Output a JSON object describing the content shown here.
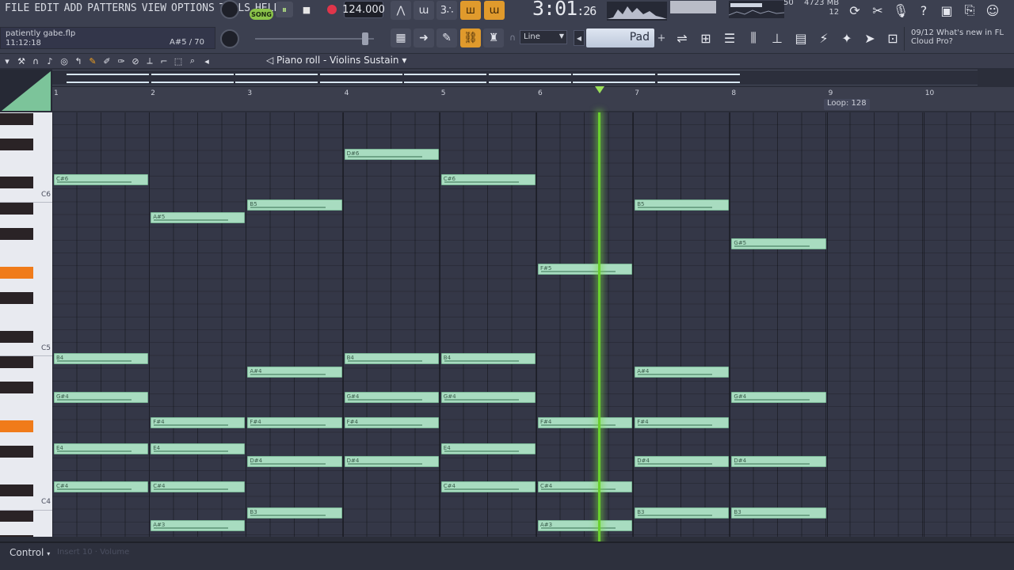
{
  "menu": [
    "FILE",
    "EDIT",
    "ADD",
    "PATTERNS",
    "VIEW",
    "OPTIONS",
    "TOOLS",
    "HELP"
  ],
  "transport": {
    "mode_label": "SONG",
    "pause": "⏸",
    "stop": "■",
    "tempo": "124.000"
  },
  "time": {
    "main": "3:01",
    "sub": "26"
  },
  "memory": {
    "top": "50",
    "mb": "4723 MB",
    "voices": "12"
  },
  "hint": {
    "file": "patiently gabe.flp",
    "time": "11:12:18",
    "note": "A#5 / 70"
  },
  "snap": {
    "value": "Line"
  },
  "preset": {
    "name": "Pad",
    "add": "+"
  },
  "news": {
    "date": "09/12",
    "text": "What's new in FL Cloud Pro?"
  },
  "pianoroll": {
    "title": "Piano roll - Violins Sustain",
    "loop": "Loop: 128"
  },
  "ruler": [
    "1",
    "2",
    "3",
    "4",
    "5",
    "6",
    "7",
    "8",
    "9",
    "10"
  ],
  "key_labels": [
    "C6",
    "C5",
    "C4"
  ],
  "control": {
    "label": "Control",
    "lane": "Insert 10 · Volume"
  },
  "notes": [
    {
      "n": "D#6",
      "bar": 4,
      "len": 1,
      "row": 3
    },
    {
      "n": "C#6",
      "bar": 1,
      "len": 1,
      "row": 5
    },
    {
      "n": "C#6",
      "bar": 5,
      "len": 1,
      "row": 5
    },
    {
      "n": "B5",
      "bar": 3,
      "len": 1,
      "row": 7
    },
    {
      "n": "B5",
      "bar": 7,
      "len": 1,
      "row": 7
    },
    {
      "n": "A#5",
      "bar": 2,
      "len": 1,
      "row": 8
    },
    {
      "n": "G#5",
      "bar": 8,
      "len": 1,
      "row": 10
    },
    {
      "n": "F#5",
      "bar": 6,
      "len": 1,
      "row": 12
    },
    {
      "n": "B4",
      "bar": 1,
      "len": 1,
      "row": 19
    },
    {
      "n": "B4",
      "bar": 4,
      "len": 1,
      "row": 19
    },
    {
      "n": "B4",
      "bar": 5,
      "len": 1,
      "row": 19
    },
    {
      "n": "A#4",
      "bar": 3,
      "len": 1,
      "row": 20
    },
    {
      "n": "A#4",
      "bar": 7,
      "len": 1,
      "row": 20
    },
    {
      "n": "G#4",
      "bar": 1,
      "len": 1,
      "row": 22
    },
    {
      "n": "G#4",
      "bar": 4,
      "len": 1,
      "row": 22
    },
    {
      "n": "G#4",
      "bar": 5,
      "len": 1,
      "row": 22
    },
    {
      "n": "G#4",
      "bar": 8,
      "len": 1,
      "row": 22
    },
    {
      "n": "F#4",
      "bar": 2,
      "len": 1,
      "row": 24
    },
    {
      "n": "F#4",
      "bar": 3,
      "len": 1,
      "row": 24
    },
    {
      "n": "F#4",
      "bar": 4,
      "len": 1,
      "row": 24
    },
    {
      "n": "F#4",
      "bar": 6,
      "len": 1,
      "row": 24
    },
    {
      "n": "F#4",
      "bar": 7,
      "len": 1,
      "row": 24
    },
    {
      "n": "E4",
      "bar": 1,
      "len": 1,
      "row": 26
    },
    {
      "n": "E4",
      "bar": 2,
      "len": 1,
      "row": 26
    },
    {
      "n": "E4",
      "bar": 5,
      "len": 1,
      "row": 26
    },
    {
      "n": "D#4",
      "bar": 3,
      "len": 1,
      "row": 27
    },
    {
      "n": "D#4",
      "bar": 4,
      "len": 1,
      "row": 27
    },
    {
      "n": "D#4",
      "bar": 7,
      "len": 1,
      "row": 27
    },
    {
      "n": "D#4",
      "bar": 8,
      "len": 1,
      "row": 27
    },
    {
      "n": "C#4",
      "bar": 1,
      "len": 1,
      "row": 29
    },
    {
      "n": "C#4",
      "bar": 2,
      "len": 1,
      "row": 29
    },
    {
      "n": "C#4",
      "bar": 5,
      "len": 1,
      "row": 29
    },
    {
      "n": "C#4",
      "bar": 6,
      "len": 1,
      "row": 29
    },
    {
      "n": "B3",
      "bar": 3,
      "len": 1,
      "row": 31
    },
    {
      "n": "B3",
      "bar": 7,
      "len": 1,
      "row": 31
    },
    {
      "n": "B3",
      "bar": 8,
      "len": 1,
      "row": 31
    },
    {
      "n": "A#3",
      "bar": 2,
      "len": 1,
      "row": 32
    },
    {
      "n": "A#3",
      "bar": 6,
      "len": 1,
      "row": 32
    }
  ],
  "colors": {
    "note": "#a8dcc0",
    "playhead": "#6ad02f",
    "accent": "#e09a2c",
    "grid": "#343747"
  }
}
